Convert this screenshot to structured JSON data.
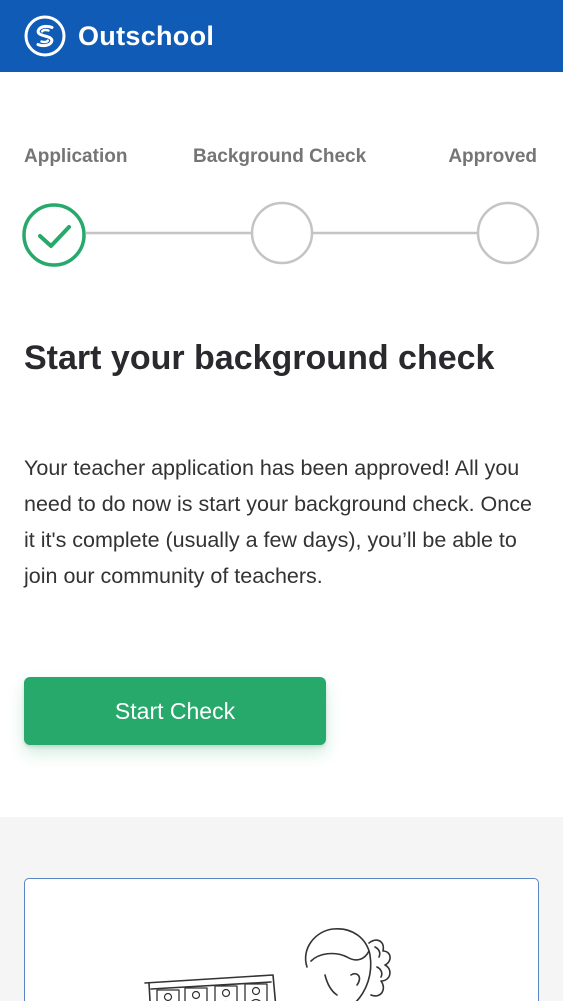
{
  "header": {
    "brand": "Outschool",
    "bg_color": "#0f5bb5",
    "logo_icon": "outschool-logo-icon"
  },
  "steps": {
    "items": [
      {
        "label": "Application",
        "status": "complete"
      },
      {
        "label": "Background Check",
        "status": "pending"
      },
      {
        "label": "Approved",
        "status": "pending"
      }
    ],
    "complete_color": "#27a96c",
    "pending_color": "#bdbdbd"
  },
  "main": {
    "title": "Start your background check",
    "body": "Your teacher application has been approved! All you need to do now is start your background check. Once it it's complete (usually a few days), you’ll be able to join our community of teachers.",
    "button_label": "Start Check",
    "button_color": "#27a96c"
  },
  "illustration": {
    "icon": "teacher-video-class-illustration"
  }
}
